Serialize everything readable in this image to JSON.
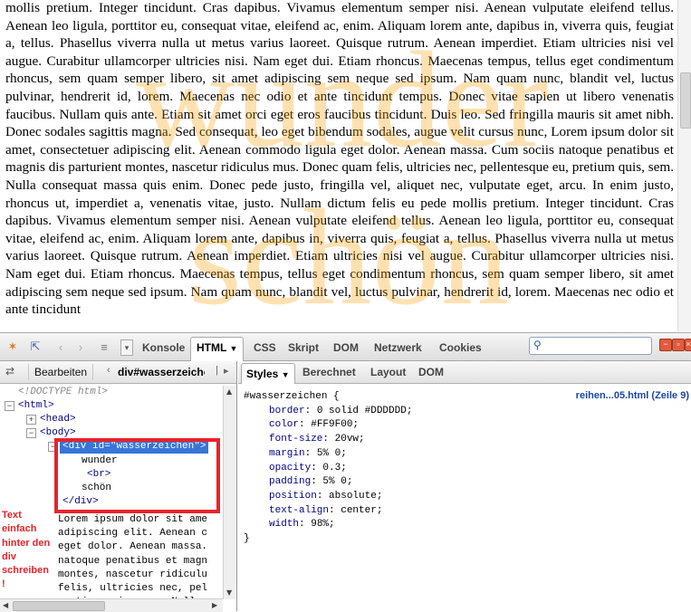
{
  "page": {
    "text": "mollis pretium. Integer tincidunt. Cras dapibus. Vivamus elementum semper nisi. Aenean vulputate eleifend tellus. Aenean leo ligula, porttitor eu, consequat vitae, eleifend ac, enim. Aliquam lorem ante, dapibus in, viverra quis, feugiat a, tellus. Phasellus viverra nulla ut metus varius laoreet. Quisque rutrum. Aenean imperdiet. Etiam ultricies nisi vel augue. Curabitur ullamcorper ultricies nisi. Nam eget dui. Etiam rhoncus. Maecenas tempus, tellus eget condimentum rhoncus, sem quam semper libero, sit amet adipiscing sem neque sed ipsum. Nam quam nunc, blandit vel, luctus pulvinar, hendrerit id, lorem. Maecenas nec odio et ante tincidunt tempus. Donec vitae sapien ut libero venenatis faucibus. Nullam quis ante. Etiam sit amet orci eget eros faucibus tincidunt. Duis leo. Sed fringilla mauris sit amet nibh. Donec sodales sagittis magna. Sed consequat, leo eget bibendum sodales, augue velit cursus nunc, Lorem ipsum dolor sit amet, consectetuer adipiscing elit. Aenean commodo ligula eget dolor. Aenean massa. Cum sociis natoque penatibus et magnis dis parturient montes, nascetur ridiculus mus. Donec quam felis, ultricies nec, pellentesque eu, pretium quis, sem. Nulla consequat massa quis enim. Donec pede justo, fringilla vel, aliquet nec, vulputate eget, arcu. In enim justo, rhoncus ut, imperdiet a, venenatis vitae, justo. Nullam dictum felis eu pede mollis pretium. Integer tincidunt. Cras dapibus. Vivamus elementum semper nisi. Aenean vulputate eleifend tellus. Aenean leo ligula, porttitor eu, consequat vitae, eleifend ac, enim. Aliquam lorem ante, dapibus in, viverra quis, feugiat a, tellus. Phasellus viverra nulla ut metus varius laoreet. Quisque rutrum. Aenean imperdiet. Etiam ultricies nisi vel augue. Curabitur ullamcorper ultricies nisi. Nam eget dui. Etiam rhoncus. Maecenas tempus, tellus eget condimentum rhoncus, sem quam semper libero, sit amet adipiscing sem neque sed ipsum. Nam quam nunc, blandit vel, luctus pulvinar, hendrerit id, lorem. Maecenas nec odio et ante tincidunt",
    "watermark_line1": "wunder",
    "watermark_line2": "schön",
    "watermark_color": "#FF9F00"
  },
  "toolbar": {
    "tabs": [
      "Konsole",
      "HTML",
      "CSS",
      "Skript",
      "DOM",
      "Netzwerk",
      "Cookies"
    ],
    "active_tab": "HTML",
    "search_value": ""
  },
  "html_panel": {
    "edit_label": "Bearbeiten",
    "breadcrumb": "div#wasserzeichen",
    "tree": {
      "doctype": "<!DOCTYPE html>",
      "html_open": "<html>",
      "head": "<head>",
      "body": "<body>",
      "div_tag": "div",
      "div_attr": "id",
      "div_value": "\"wasserzeichen\"",
      "text1": "wunder",
      "br": "<br>",
      "text2": "schön",
      "div_close": "</div>",
      "lorem": "Lorem ipsum dolor sit ame\nadipiscing elit. Aenean c\neget dolor. Aenean massa.\nnatoque penatibus et magn\nmontes, nascetur ridiculu\nfelis, ultricies nec, pel\npretium quis, sem. Nulla"
    },
    "annotation": "Text einfach hinter den div schreiben !"
  },
  "style_panel": {
    "tabs": [
      "Styles",
      "Berechnet",
      "Layout",
      "DOM"
    ],
    "active_tab": "Styles",
    "selector": "#wasserzeichen {",
    "source": "reihen...05.html (Zeile 9)",
    "properties": [
      {
        "name": "border",
        "value": "0 solid #DDDDDD;"
      },
      {
        "name": "color",
        "value": "#FF9F00;"
      },
      {
        "name": "font-size",
        "value": "20vw;"
      },
      {
        "name": "margin",
        "value": "5% 0;"
      },
      {
        "name": "opacity",
        "value": "0.3;"
      },
      {
        "name": "padding",
        "value": "5% 0;"
      },
      {
        "name": "position",
        "value": "absolute;"
      },
      {
        "name": "text-align",
        "value": "center;"
      },
      {
        "name": "width",
        "value": "98%;"
      }
    ],
    "close_brace": "}"
  },
  "colors": {
    "annotation_red": "#e8232b",
    "selection_blue": "#3875d7",
    "link_blue": "#1b46a6"
  }
}
